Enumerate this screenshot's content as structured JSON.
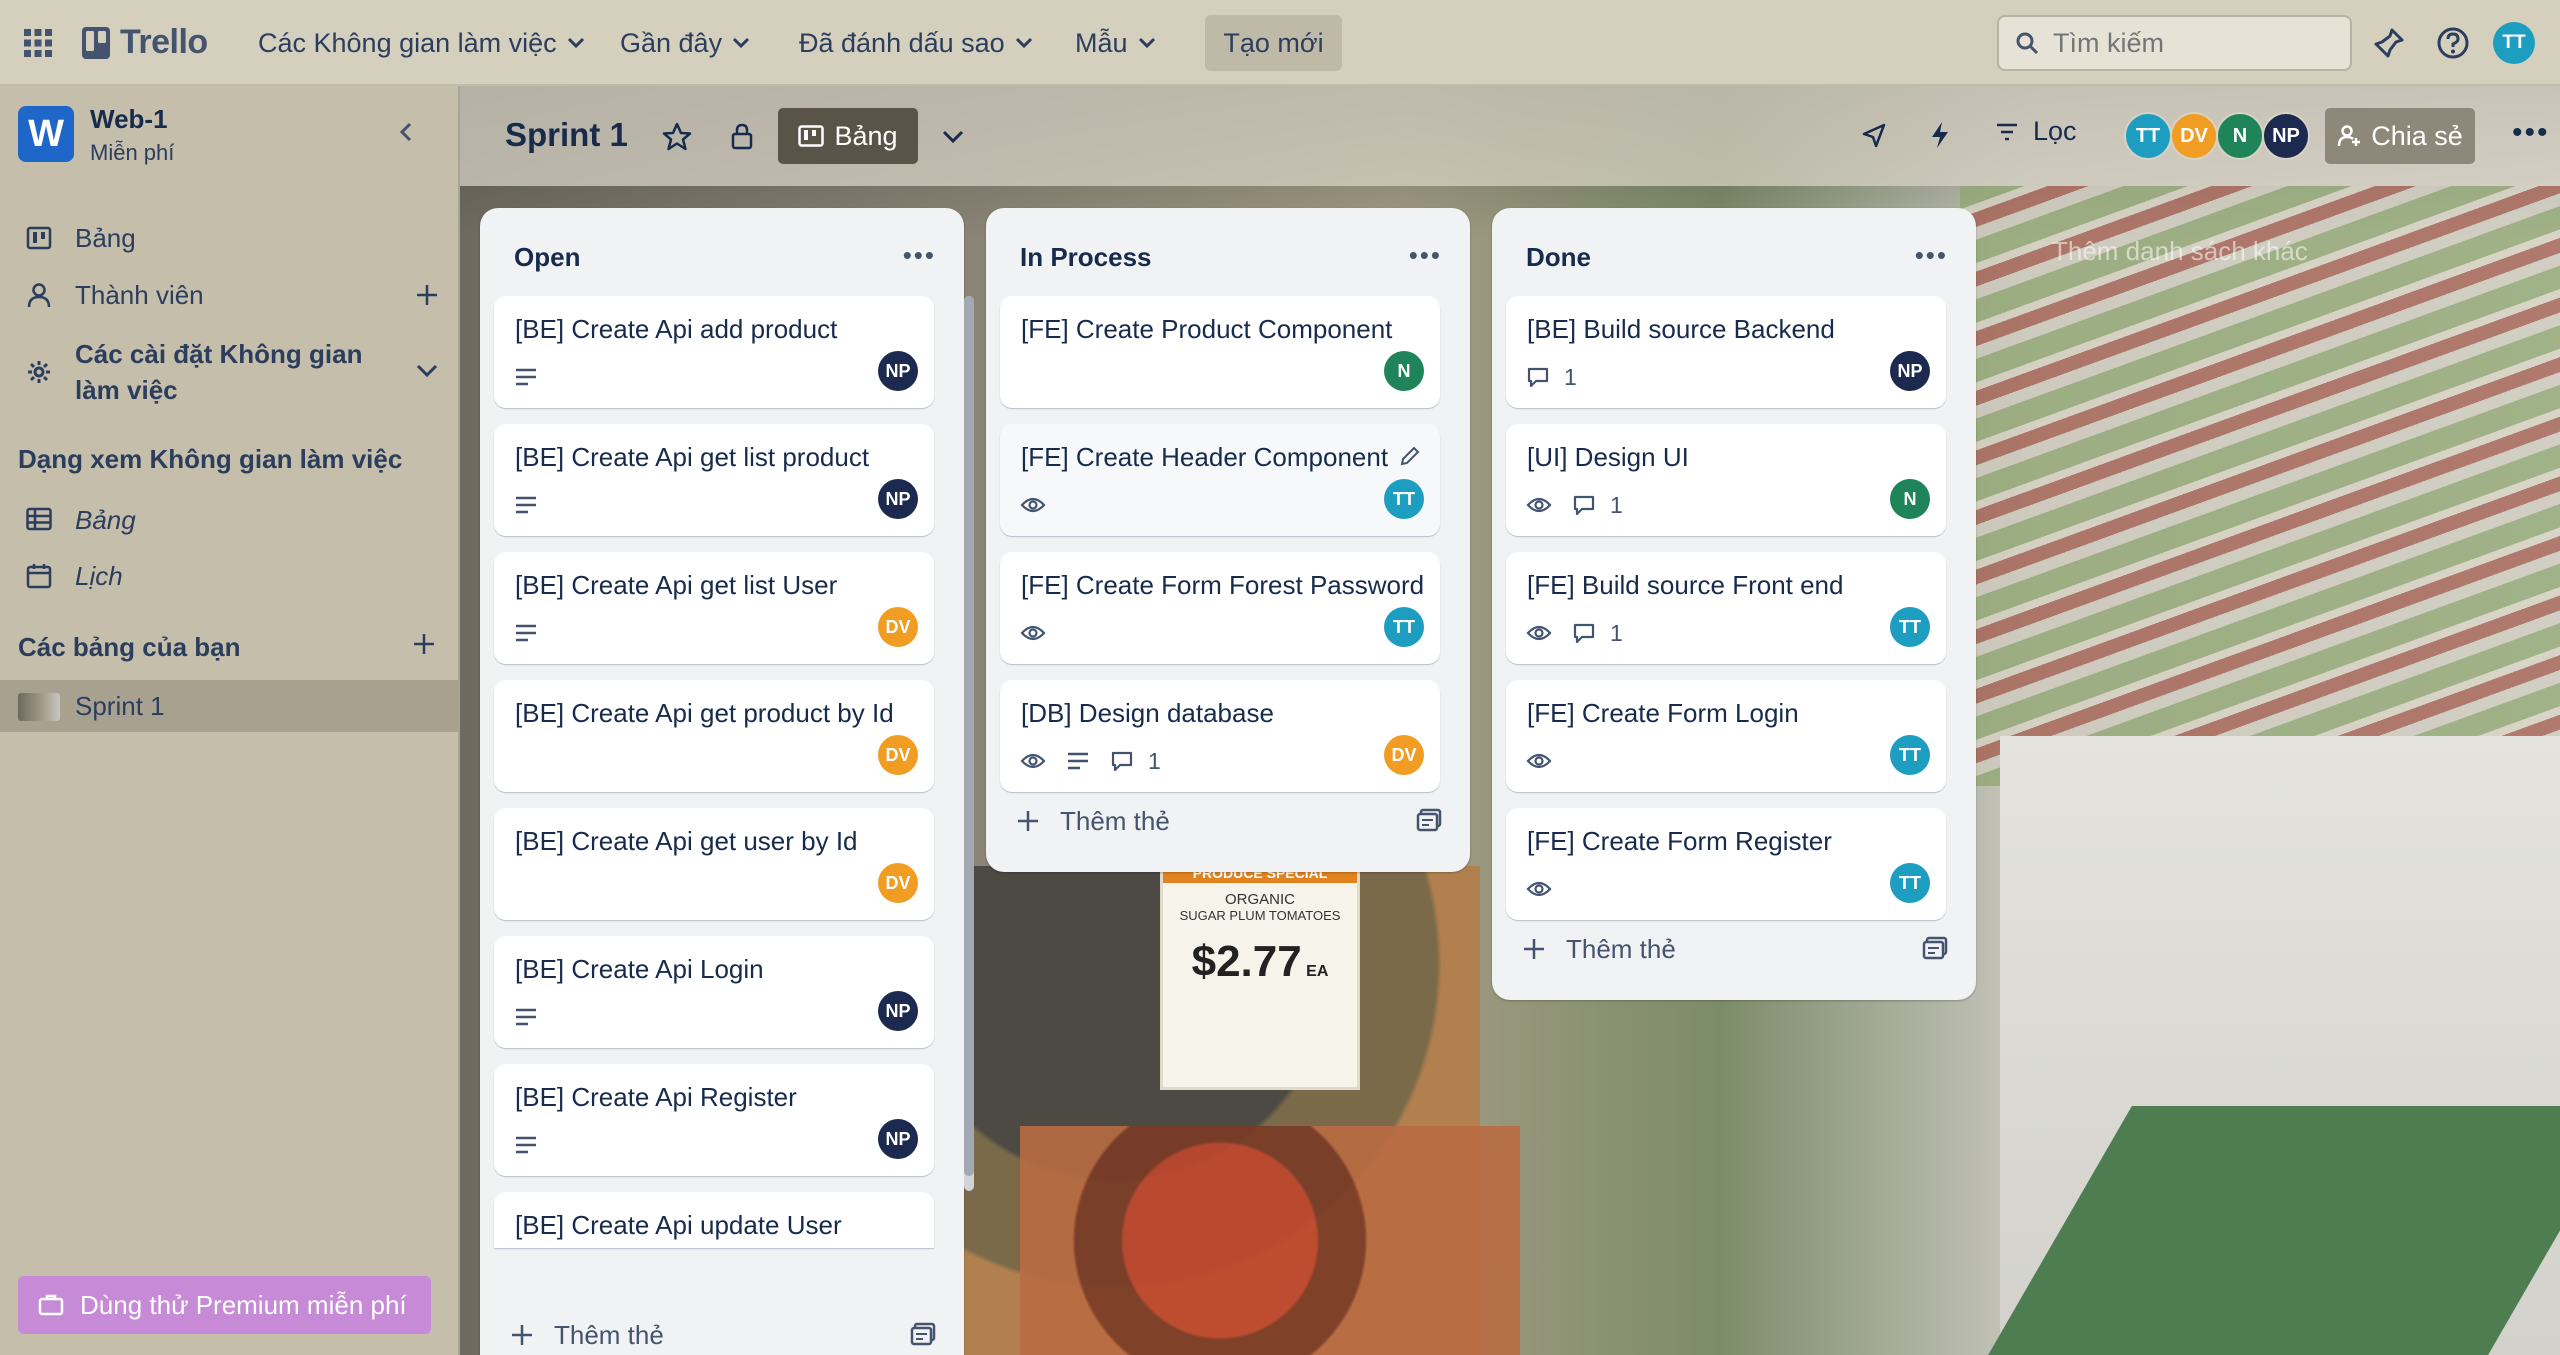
{
  "topbar": {
    "logo": "Trello",
    "menus": [
      "Các Không gian làm việc",
      "Gần đây",
      "Đã đánh dấu sao",
      "Mẫu"
    ],
    "create": "Tạo mới",
    "search_placeholder": "Tìm kiếm",
    "user_initials": "TT"
  },
  "sidebar": {
    "workspace_name": "Web-1",
    "workspace_letter": "W",
    "workspace_plan": "Miễn phí",
    "items": [
      "Bảng",
      "Thành viên",
      "Các cài đặt Không gian làm việc"
    ],
    "views_heading": "Dạng xem Không gian làm việc",
    "views": [
      "Bảng",
      "Lịch"
    ],
    "boards_heading": "Các bảng của bạn",
    "boards": [
      "Sprint 1"
    ],
    "premium": "Dùng thử Premium miễn phí"
  },
  "board": {
    "title": "Sprint 1",
    "view": "Bảng",
    "filter": "Lọc",
    "share": "Chia sẻ",
    "members": [
      {
        "initials": "TT",
        "color": "#1d9dc0"
      },
      {
        "initials": "DV",
        "color": "#f19c23"
      },
      {
        "initials": "N",
        "color": "#1f845a"
      },
      {
        "initials": "NP",
        "color": "#1d2a4f"
      }
    ],
    "add_list": "Thêm danh sách khác",
    "add_card": "Thêm thẻ"
  },
  "lists": [
    {
      "title": "Open",
      "cards": [
        {
          "title": "[BE] Create Api add product",
          "badges": [
            "description"
          ],
          "member": "NP"
        },
        {
          "title": "[BE] Create Api get list product",
          "badges": [
            "description"
          ],
          "member": "NP"
        },
        {
          "title": "[BE] Create Api get list User",
          "badges": [
            "description"
          ],
          "member": "DV"
        },
        {
          "title": "[BE] Create Api get product by Id",
          "badges": [],
          "member": "DV"
        },
        {
          "title": "[BE] Create Api get user by Id",
          "badges": [],
          "member": "DV"
        },
        {
          "title": "[BE] Create Api Login",
          "badges": [
            "description"
          ],
          "member": "NP"
        },
        {
          "title": "[BE] Create Api Register",
          "badges": [
            "description"
          ],
          "member": "NP"
        },
        {
          "title": "[BE] Create Api update User",
          "badges": [],
          "member": ""
        }
      ]
    },
    {
      "title": "In Process",
      "cards": [
        {
          "title": "[FE] Create Product Component",
          "badges": [],
          "member": "N"
        },
        {
          "title": "[FE] Create Header Component",
          "badges": [
            "watch"
          ],
          "member": "TT"
        },
        {
          "title": "[FE] Create Form Forest Password",
          "badges": [
            "watch"
          ],
          "member": "TT"
        },
        {
          "title": "[DB] Design database",
          "badges": [
            "watch",
            "description",
            "comments"
          ],
          "comments": "1",
          "member": "DV"
        }
      ]
    },
    {
      "title": "Done",
      "cards": [
        {
          "title": "[BE] Build source Backend",
          "badges": [
            "comments"
          ],
          "comments": "1",
          "member": "NP"
        },
        {
          "title": "[UI] Design UI",
          "badges": [
            "watch",
            "comments"
          ],
          "comments": "1",
          "member": "N"
        },
        {
          "title": "[FE] Build source Front end",
          "badges": [
            "watch",
            "comments"
          ],
          "comments": "1",
          "member": "TT"
        },
        {
          "title": "[FE] Create Form Login",
          "badges": [
            "watch"
          ],
          "member": "TT"
        },
        {
          "title": "[FE] Create Form Register",
          "badges": [
            "watch"
          ],
          "member": "TT"
        }
      ]
    }
  ],
  "background_label": {
    "sign_top": "PRODUCE SPECIAL",
    "sign_line1": "ORGANIC",
    "sign_line2": "SUGAR PLUM TOMATOES",
    "price": "$2.77",
    "unit": "EA"
  }
}
